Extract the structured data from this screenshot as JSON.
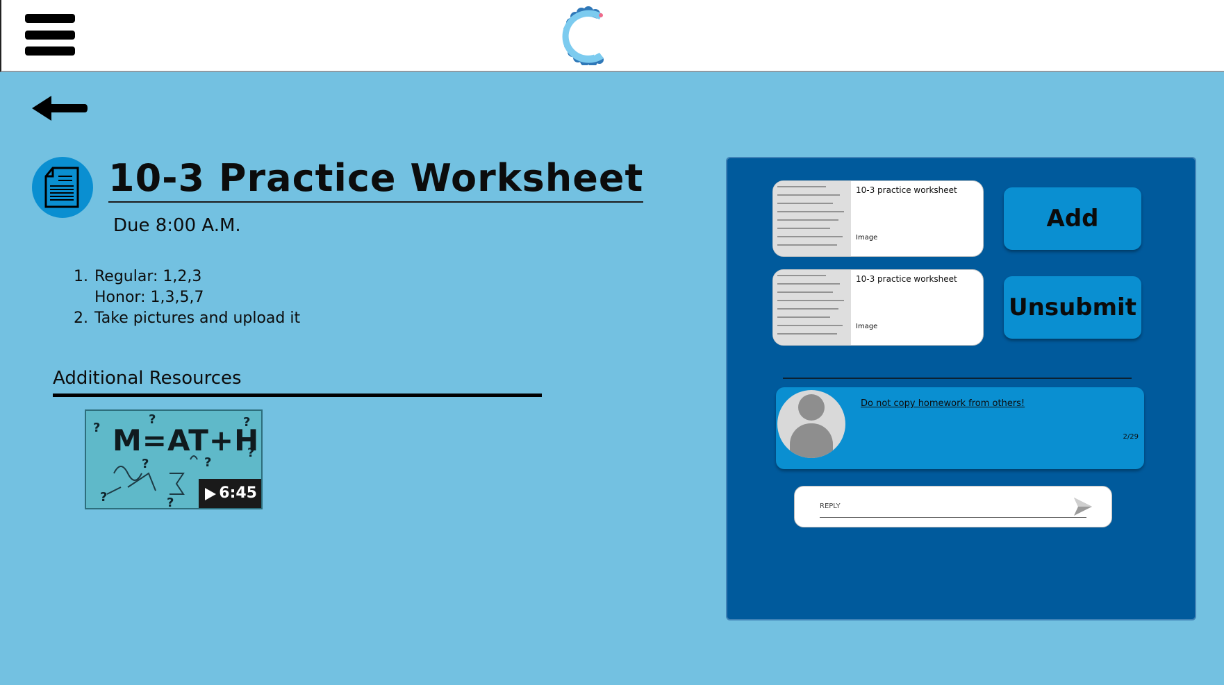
{
  "header": {
    "menu_icon": "hamburger-menu-icon",
    "logo": "app-logo-c"
  },
  "nav": {
    "back_icon": "back-arrow-icon"
  },
  "assignment": {
    "icon": "document-icon",
    "title": "10-3 Practice Worksheet",
    "due": "Due 8:00 A.M.",
    "instructions": [
      {
        "number": "1.",
        "text": "Regular: 1,2,3"
      },
      {
        "number": "",
        "text": "Honor: 1,3,5,7"
      },
      {
        "number": "2.",
        "text": "Take pictures and upload it"
      }
    ]
  },
  "resources": {
    "heading": "Additional Resources",
    "video": {
      "thumbnail_text": "M=AT+H",
      "duration": "6:45",
      "play_icon": "play-icon"
    }
  },
  "submission": {
    "attachments": [
      {
        "title": "10-3 practice worksheet",
        "type": "Image"
      },
      {
        "title": "10-3 practice worksheet",
        "type": "Image"
      }
    ],
    "add_label": "Add",
    "unsubmit_label": "Unsubmit",
    "comment": {
      "text": "Do not copy homework from others!",
      "date": "2/29"
    },
    "reply": {
      "placeholder": "REPLY",
      "send_icon": "send-icon"
    }
  },
  "colors": {
    "background": "#73c1e1",
    "panel": "#005a9c",
    "accent": "#0a8fd1",
    "header": "#ffffff"
  }
}
